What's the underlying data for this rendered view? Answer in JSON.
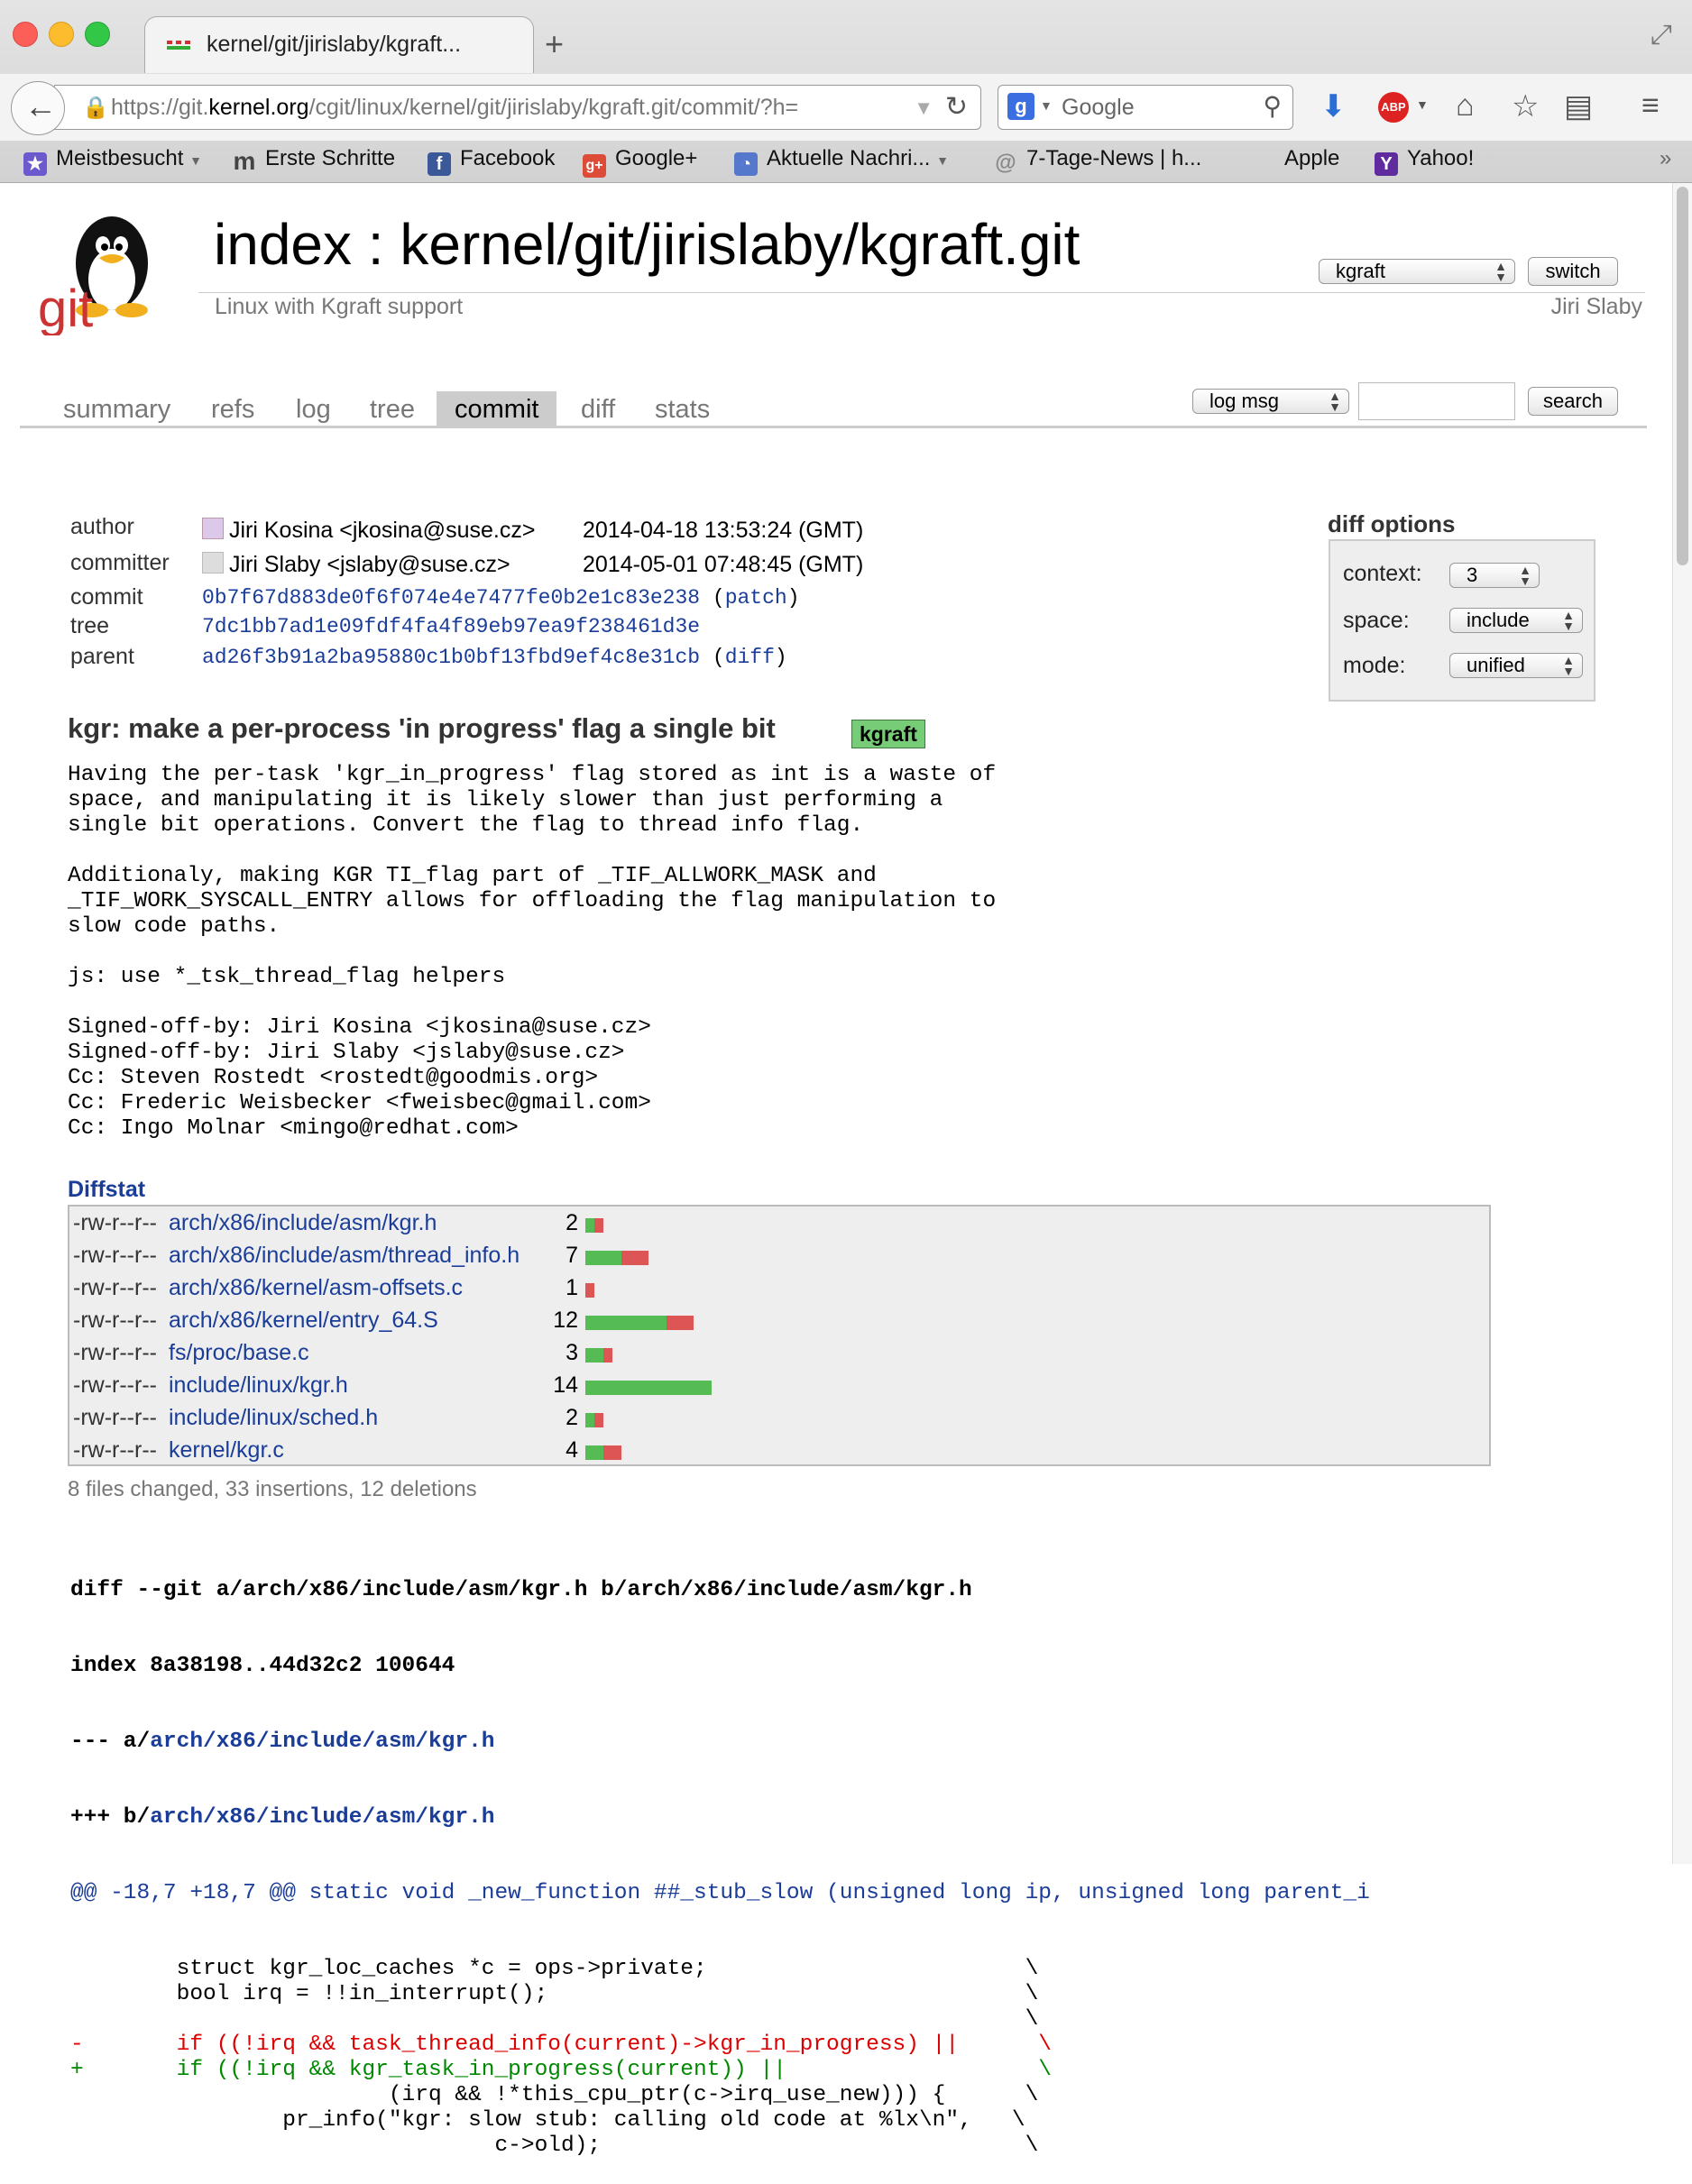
{
  "browser": {
    "tab_title": "kernel/git/jirislaby/kgraft...",
    "url_host_prefix": "https://git.",
    "url_host_domain": "kernel.org",
    "url_path": "/cgit/linux/kernel/git/jirislaby/kgraft.git/commit/?h=",
    "search_engine_placeholder": "Google",
    "bookmarks": [
      {
        "label": "Meistbesucht",
        "icon": "star-folder-icon",
        "color": "#6a5acd"
      },
      {
        "label": "Erste Schritte",
        "icon": "m-logo-icon",
        "color": "#444444"
      },
      {
        "label": "Facebook",
        "icon": "facebook-icon",
        "color": "#3b5998"
      },
      {
        "label": "Google+",
        "icon": "google-plus-icon",
        "color": "#dd4b39"
      },
      {
        "label": "Aktuelle Nachri...",
        "icon": "rss-icon",
        "color": "#5577cc"
      },
      {
        "label": "7-Tage-News | h...",
        "icon": "at-icon",
        "color": "#888888"
      },
      {
        "label": "Apple",
        "icon": "apple-icon",
        "color": "#666666"
      },
      {
        "label": "Yahoo!",
        "icon": "yahoo-icon",
        "color": "#5f2b9e"
      }
    ]
  },
  "header": {
    "title": "index : kernel/git/jirislaby/kgraft.git",
    "description": "Linux with Kgraft support",
    "owner": "Jiri Slaby",
    "branch_select": "kgraft",
    "switch_label": "switch"
  },
  "tabs": [
    "summary",
    "refs",
    "log",
    "tree",
    "commit",
    "diff",
    "stats"
  ],
  "active_tab": "commit",
  "search": {
    "mode": "log msg",
    "button": "search"
  },
  "commit": {
    "author_label": "author",
    "author": "Jiri Kosina <jkosina@suse.cz>",
    "author_date": "2014-04-18 13:53:24 (GMT)",
    "committer_label": "committer",
    "committer": "Jiri Slaby <jslaby@suse.cz>",
    "committer_date": "2014-05-01 07:48:45 (GMT)",
    "commit_label": "commit",
    "commit_hash": "0b7f67d883de0f6f074e4e7477fe0b2e1c83e238",
    "patch_link": "patch",
    "tree_label": "tree",
    "tree_hash": "7dc1bb7ad1e09fdf4fa4f89eb97ea9f238461d3e",
    "parent_label": "parent",
    "parent_hash": "ad26f3b91a2ba95880c1b0bf13fbd9ef4c8e31cb",
    "diff_link": "diff",
    "subject": "kgr: make a per-process 'in progress' flag a single bit",
    "badge": "kgraft",
    "message": "Having the per-task 'kgr_in_progress' flag stored as int is a waste of\nspace, and manipulating it is likely slower than just performing a\nsingle bit operations. Convert the flag to thread info flag.\n\nAdditionaly, making KGR TI_flag part of _TIF_ALLWORK_MASK and\n_TIF_WORK_SYSCALL_ENTRY allows for offloading the flag manipulation to\nslow code paths.\n\njs: use *_tsk_thread_flag helpers\n\nSigned-off-by: Jiri Kosina <jkosina@suse.cz>\nSigned-off-by: Jiri Slaby <jslaby@suse.cz>\nCc: Steven Rostedt <rostedt@goodmis.org>\nCc: Frederic Weisbecker <fweisbec@gmail.com>\nCc: Ingo Molnar <mingo@redhat.com>"
  },
  "diff_options": {
    "title": "diff options",
    "context_label": "context:",
    "context_value": "3",
    "space_label": "space:",
    "space_value": "include",
    "mode_label": "mode:",
    "mode_value": "unified"
  },
  "diffstat": {
    "title": "Diffstat",
    "rows": [
      {
        "mode": "-rw-r--r--",
        "file": "arch/x86/include/asm/kgr.h",
        "changes": "2",
        "ins": 1,
        "del": 1
      },
      {
        "mode": "-rw-r--r--",
        "file": "arch/x86/include/asm/thread_info.h",
        "changes": "7",
        "ins": 4,
        "del": 3
      },
      {
        "mode": "-rw-r--r--",
        "file": "arch/x86/kernel/asm-offsets.c",
        "changes": "1",
        "ins": 0,
        "del": 1
      },
      {
        "mode": "-rw-r--r--",
        "file": "arch/x86/kernel/entry_64.S",
        "changes": "12",
        "ins": 9,
        "del": 3
      },
      {
        "mode": "-rw-r--r--",
        "file": "fs/proc/base.c",
        "changes": "3",
        "ins": 2,
        "del": 1
      },
      {
        "mode": "-rw-r--r--",
        "file": "include/linux/kgr.h",
        "changes": "14",
        "ins": 14,
        "del": 0
      },
      {
        "mode": "-rw-r--r--",
        "file": "include/linux/sched.h",
        "changes": "2",
        "ins": 1,
        "del": 1
      },
      {
        "mode": "-rw-r--r--",
        "file": "kernel/kgr.c",
        "changes": "4",
        "ins": 2,
        "del": 2
      }
    ],
    "summary": "8 files changed, 33 insertions, 12 deletions"
  },
  "diff": {
    "header1": "diff --git a/arch/x86/include/asm/kgr.h b/arch/x86/include/asm/kgr.h",
    "header2": "index 8a38198..44d32c2 100644",
    "old_prefix": "--- a/",
    "old_file": "arch/x86/include/asm/kgr.h",
    "new_prefix": "+++ b/",
    "new_file": "arch/x86/include/asm/kgr.h",
    "hunk": "@@ -18,7 +18,7 @@ static void _new_function ##_stub_slow (unsigned long ip, unsigned long parent_i",
    "lines": [
      {
        "type": "ctx",
        "text": "        struct kgr_loc_caches *c = ops->private;                        \\"
      },
      {
        "type": "ctx",
        "text": "        bool irq = !!in_interrupt();                                    \\"
      },
      {
        "type": "ctx",
        "text": "                                                                        \\"
      },
      {
        "type": "minus",
        "text": "-       if ((!irq && task_thread_info(current)->kgr_in_progress) ||      \\"
      },
      {
        "type": "plus",
        "text": "+       if ((!irq && kgr_task_in_progress(current)) ||                   \\"
      },
      {
        "type": "ctx",
        "text": "                        (irq && !*this_cpu_ptr(c->irq_use_new))) {      \\"
      },
      {
        "type": "ctx",
        "text": "                pr_info(\"kgr: slow stub: calling old code at %lx\\n\",   \\"
      },
      {
        "type": "ctx",
        "text": "                                c->old);                                \\"
      }
    ]
  }
}
